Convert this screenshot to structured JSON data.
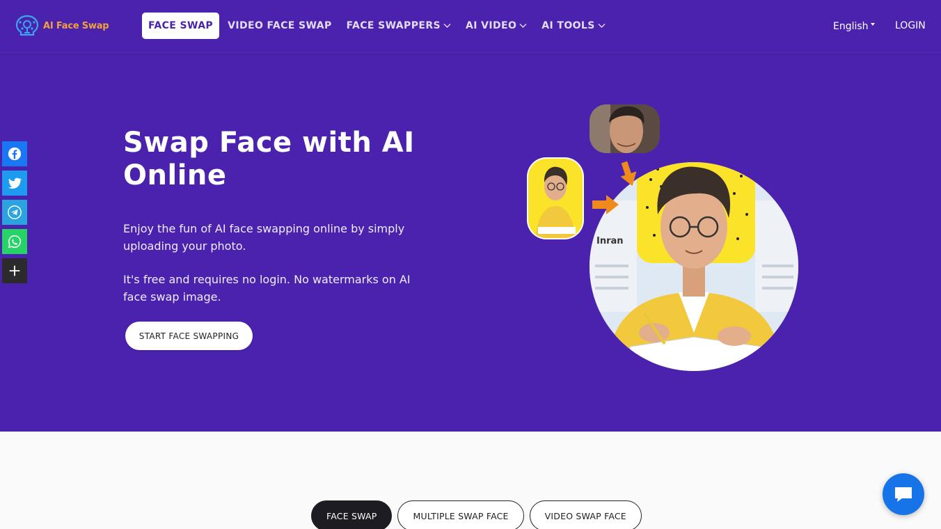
{
  "brand": {
    "name": "AI Face Swap",
    "name_color": "#f2a23c",
    "icon": "brain-bulb-icon"
  },
  "colors": {
    "hero_bg": "#4a22ae",
    "page_bg": "#fafafa",
    "active_tab_bg": "#1c1c22",
    "chat_bg": "#1674e8"
  },
  "nav": {
    "items": [
      {
        "label": "FACE SWAP",
        "active": true,
        "dropdown": false
      },
      {
        "label": "VIDEO FACE SWAP",
        "active": false,
        "dropdown": false
      },
      {
        "label": "FACE SWAPPERS",
        "active": false,
        "dropdown": true
      },
      {
        "label": "AI VIDEO",
        "active": false,
        "dropdown": true
      },
      {
        "label": "AI TOOLS",
        "active": false,
        "dropdown": true
      }
    ],
    "language": "English",
    "login": "LOGIN"
  },
  "hero": {
    "title": "Swap Face with AI Online",
    "description_1": "Enjoy the fun of AI face swapping online by simply uploading your photo.",
    "description_2": "It's free and requires no login. No watermarks on AI face swap image.",
    "cta": "START FACE SWAPPING",
    "image_screen_text": "Inran"
  },
  "social": [
    {
      "name": "facebook",
      "icon": "facebook-icon",
      "color": "#1877f2"
    },
    {
      "name": "twitter",
      "icon": "twitter-icon",
      "color": "#1d9bf0"
    },
    {
      "name": "telegram",
      "icon": "telegram-icon",
      "color": "#2aa3df"
    },
    {
      "name": "whatsapp",
      "icon": "whatsapp-icon",
      "color": "#25d366"
    },
    {
      "name": "more",
      "icon": "plus-icon",
      "color": "#2b2b2b"
    }
  ],
  "tabs": [
    {
      "label": "FACE SWAP",
      "active": true
    },
    {
      "label": "MULTIPLE SWAP FACE",
      "active": false
    },
    {
      "label": "VIDEO SWAP FACE",
      "active": false
    }
  ],
  "chat": {
    "icon": "chat-bubble-icon"
  }
}
